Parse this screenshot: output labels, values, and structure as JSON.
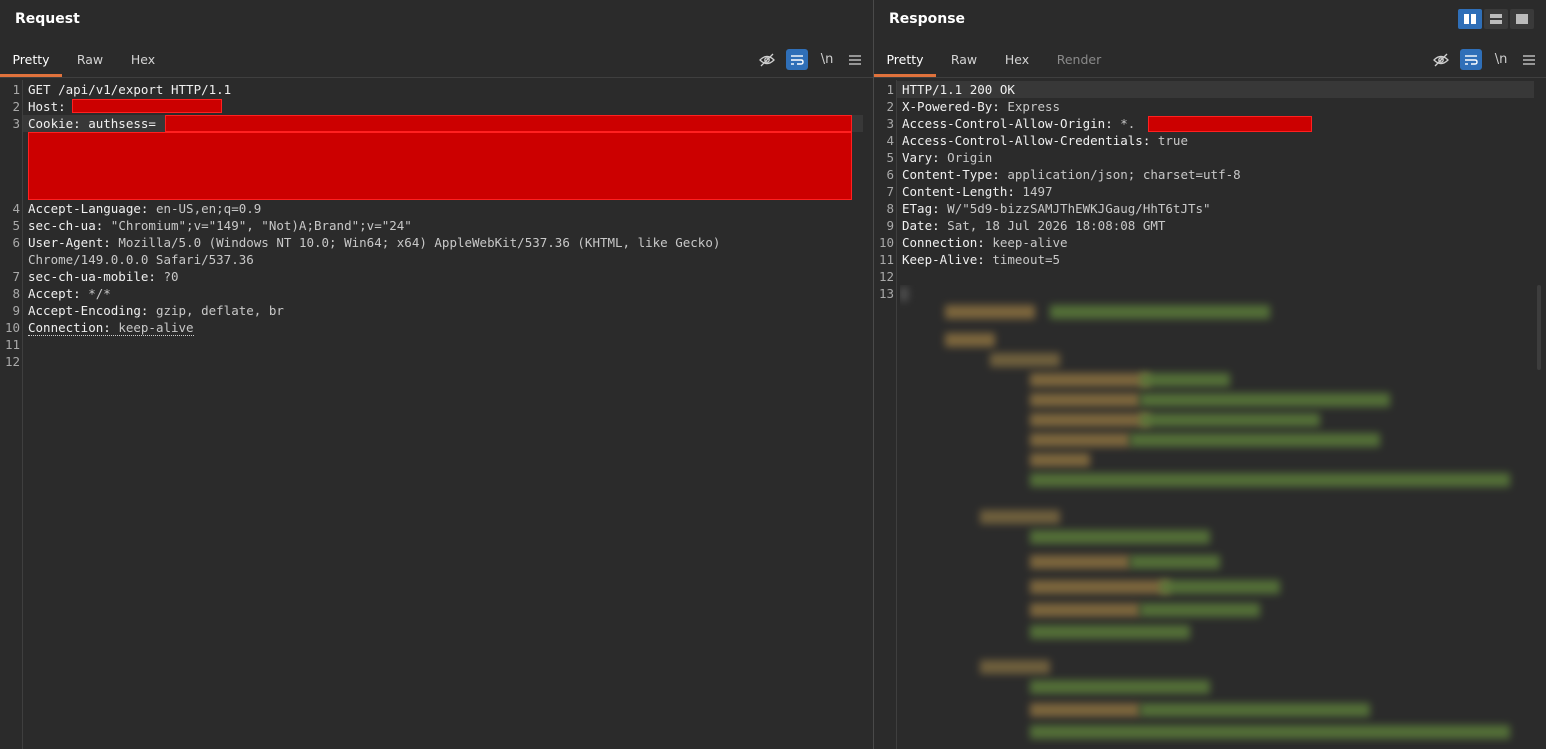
{
  "request": {
    "title": "Request",
    "tabs": [
      "Pretty",
      "Raw",
      "Hex"
    ],
    "active_tab": "Pretty",
    "line_numbers": [
      "1",
      "2",
      "3",
      "4",
      "5",
      "6",
      "7",
      "8",
      "9",
      "10",
      "11",
      "12"
    ],
    "lines": [
      {
        "key": "GET /api/v1/export HTTP/1.1",
        "val": ""
      },
      {
        "key": "Host:",
        "val": ""
      },
      {
        "key": "Cookie: authsess=",
        "val": ""
      },
      {
        "key": "Accept-Language:",
        "val": " en-US,en;q=0.9"
      },
      {
        "key": "sec-ch-ua:",
        "val": " \"Chromium\";v=\"149\", \"Not)A;Brand\";v=\"24\""
      },
      {
        "key": "User-Agent:",
        "val": " Mozilla/5.0 (Windows NT 10.0; Win64; x64) AppleWebKit/537.36 (KHTML, like Gecko)"
      },
      {
        "key": "",
        "val": "Chrome/149.0.0.0 Safari/537.36"
      },
      {
        "key": "sec-ch-ua-mobile:",
        "val": " ?0"
      },
      {
        "key": "Accept:",
        "val": " */*"
      },
      {
        "key": "Accept-Encoding:",
        "val": " gzip, deflate, br"
      },
      {
        "key": "Connection:",
        "val": " keep-alive"
      }
    ]
  },
  "response": {
    "title": "Response",
    "tabs": [
      "Pretty",
      "Raw",
      "Hex",
      "Render"
    ],
    "active_tab": "Pretty",
    "line_numbers": [
      "1",
      "2",
      "3",
      "4",
      "5",
      "6",
      "7",
      "8",
      "9",
      "10",
      "11",
      "12",
      "13"
    ],
    "lines": [
      {
        "key": "HTTP/1.1 200 OK",
        "val": ""
      },
      {
        "key": "X-Powered-By:",
        "val": " Express"
      },
      {
        "key": "Access-Control-Allow-Origin:",
        "val": " *."
      },
      {
        "key": "Access-Control-Allow-Credentials:",
        "val": " true"
      },
      {
        "key": "Vary:",
        "val": " Origin"
      },
      {
        "key": "Content-Type:",
        "val": " application/json; charset=utf-8"
      },
      {
        "key": "Content-Length:",
        "val": " 1497"
      },
      {
        "key": "ETag:",
        "val": " W/\"5d9-bizzSAMJThEWKJGaug/HhT6tJTs\""
      },
      {
        "key": "Date:",
        "val": " Sat, 18 Jul 2026 18:08:08 GMT"
      },
      {
        "key": "Connection:",
        "val": " keep-alive"
      },
      {
        "key": "Keep-Alive:",
        "val": " timeout=5"
      }
    ]
  },
  "toolbar_icons": [
    "hide-icon",
    "wrap-icon",
    "newline-icon",
    "menu-icon"
  ],
  "newline_label": "\\n",
  "layout_icons": [
    "split-vertical-icon",
    "split-horizontal-icon",
    "single-pane-icon"
  ],
  "colors": {
    "accent": "#e0723c",
    "active_button": "#2f6fb8",
    "redaction": "#cc0000"
  }
}
